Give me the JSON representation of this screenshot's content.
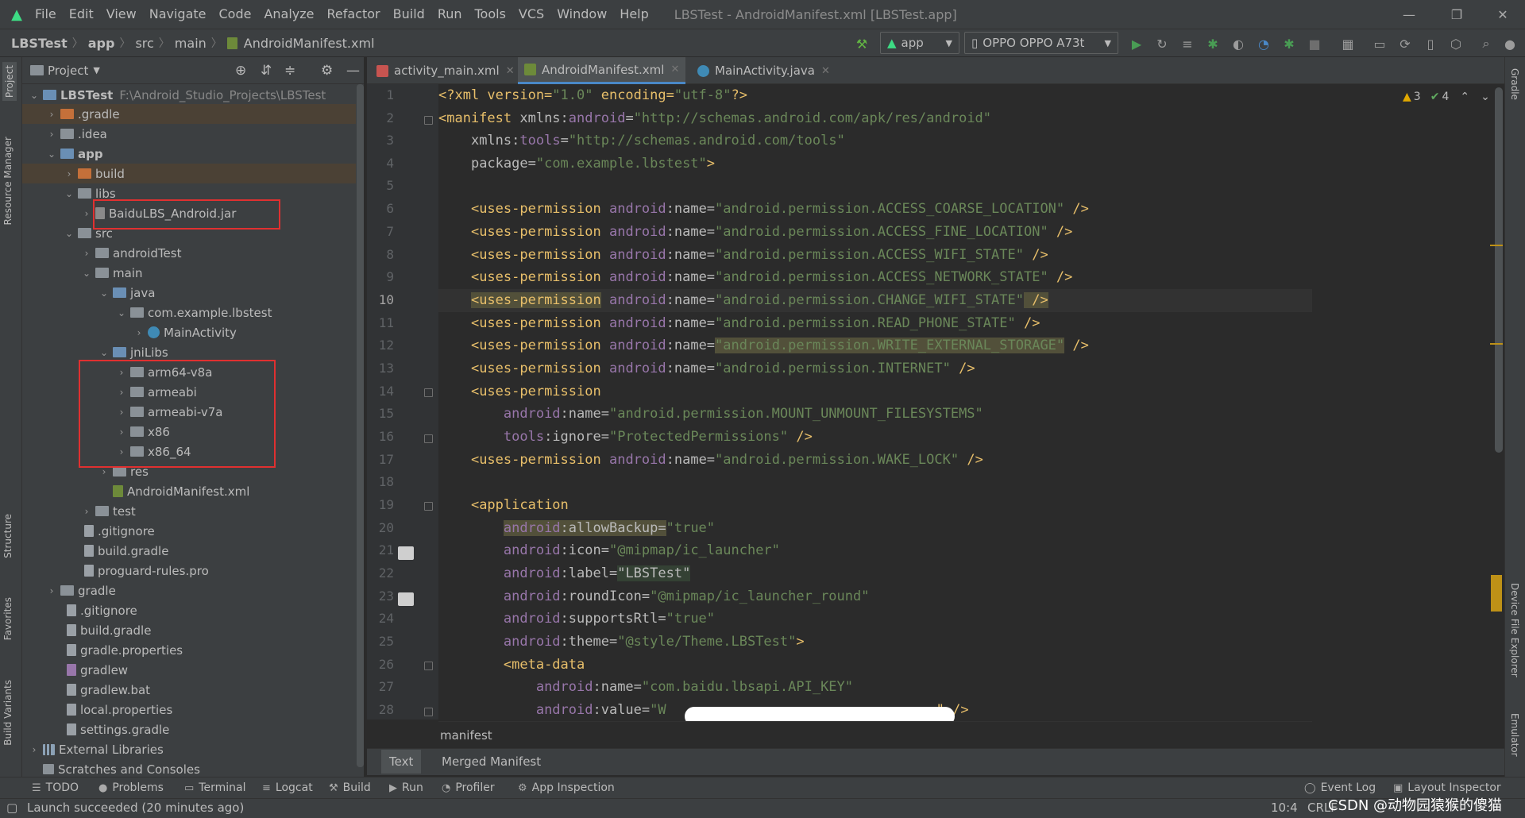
{
  "window": {
    "title": "LBSTest - AndroidManifest.xml [LBSTest.app]"
  },
  "menu": [
    "File",
    "Edit",
    "View",
    "Navigate",
    "Code",
    "Analyze",
    "Refactor",
    "Build",
    "Run",
    "Tools",
    "VCS",
    "Window",
    "Help"
  ],
  "breadcrumb": [
    "LBSTest",
    "app",
    "src",
    "main",
    "AndroidManifest.xml"
  ],
  "toolbar": {
    "run_config": "app",
    "device": "OPPO OPPO A73t"
  },
  "left_tool_tabs": [
    "Project",
    "Resource Manager",
    "Structure",
    "Favorites",
    "Build Variants"
  ],
  "right_tool_tabs": [
    "Gradle",
    "Device File Explorer",
    "Emulator"
  ],
  "project_panel": {
    "title": "Project",
    "tree": [
      {
        "label": "LBSTest",
        "extra": "F:\\Android_Studio_Projects\\LBSTest"
      },
      {
        "label": ".gradle"
      },
      {
        "label": ".idea"
      },
      {
        "label": "app"
      },
      {
        "label": "build"
      },
      {
        "label": "libs"
      },
      {
        "label": "BaiduLBS_Android.jar"
      },
      {
        "label": "src"
      },
      {
        "label": "androidTest"
      },
      {
        "label": "main"
      },
      {
        "label": "java"
      },
      {
        "label": "com.example.lbstest"
      },
      {
        "label": "MainActivity"
      },
      {
        "label": "jniLibs"
      },
      {
        "label": "arm64-v8a"
      },
      {
        "label": "armeabi"
      },
      {
        "label": "armeabi-v7a"
      },
      {
        "label": "x86"
      },
      {
        "label": "x86_64"
      },
      {
        "label": "res"
      },
      {
        "label": "AndroidManifest.xml"
      },
      {
        "label": "test"
      },
      {
        "label": ".gitignore"
      },
      {
        "label": "build.gradle"
      },
      {
        "label": "proguard-rules.pro"
      },
      {
        "label": "gradle"
      },
      {
        "label": ".gitignore"
      },
      {
        "label": "build.gradle"
      },
      {
        "label": "gradle.properties"
      },
      {
        "label": "gradlew"
      },
      {
        "label": "gradlew.bat"
      },
      {
        "label": "local.properties"
      },
      {
        "label": "settings.gradle"
      },
      {
        "label": "External Libraries"
      },
      {
        "label": "Scratches and Consoles"
      }
    ]
  },
  "editor_tabs": [
    "activity_main.xml",
    "AndroidManifest.xml",
    "MainActivity.java"
  ],
  "inspections": {
    "warnings": "3",
    "weak_warnings": "4"
  },
  "code": {
    "line_numbers": [
      "1",
      "2",
      "3",
      "4",
      "5",
      "6",
      "7",
      "8",
      "9",
      "10",
      "11",
      "12",
      "13",
      "14",
      "15",
      "16",
      "17",
      "18",
      "19",
      "20",
      "21",
      "22",
      "23",
      "24",
      "25",
      "26",
      "27",
      "28"
    ],
    "l1": {
      "t1": "<?xml version=",
      "t2": "\"1.0\"",
      "t3": " encoding=",
      "t4": "\"utf-8\"",
      "t5": "?>"
    },
    "l2": {
      "t1": "<manifest ",
      "t2": "xmlns:",
      "t3": "android",
      "t4": "=",
      "t5": "\"http://schemas.android.com/apk/res/android\""
    },
    "l3": {
      "t1": "xmlns:",
      "t2": "tools",
      "t3": "=",
      "t4": "\"http://schemas.android.com/tools\""
    },
    "l4": {
      "t1": "package=",
      "t2": "\"com.example.lbstest\"",
      "t3": ">"
    },
    "tag_uses_permission": "<uses-permission",
    "attr_android": "android",
    "attr_name": ":name=",
    "close_tag": " />",
    "permissions": [
      "\"android.permission.ACCESS_COARSE_LOCATION\"",
      "\"android.permission.ACCESS_FINE_LOCATION\"",
      "\"android.permission.ACCESS_WIFI_STATE\"",
      "\"android.permission.ACCESS_NETWORK_STATE\"",
      "\"android.permission.CHANGE_WIFI_STATE\"",
      "\"android.permission.READ_PHONE_STATE\"",
      "\"android.permission.WRITE_EXTERNAL_STORAGE\"",
      "\"android.permission.INTERNET\""
    ],
    "l15_value": "\"android.permission.MOUNT_UNMOUNT_FILESYSTEMS\"",
    "l16": {
      "t1": "tools",
      "t2": ":ignore=",
      "t3": "\"ProtectedPermissions\"",
      "t4": " />"
    },
    "l17_value": "\"android.permission.WAKE_LOCK\"",
    "l19": "<application",
    "app_attrs": [
      {
        "name": ":allowBackup=",
        "value": "\"true\""
      },
      {
        "name": ":icon=",
        "value": "\"@mipmap/ic_launcher\""
      },
      {
        "name": ":label=",
        "value": "\"LBSTest\""
      },
      {
        "name": ":roundIcon=",
        "value": "\"@mipmap/ic_launcher_round\""
      },
      {
        "name": ":supportsRtl=",
        "value": "\"true\""
      },
      {
        "name": ":theme=",
        "value": "\"@style/Theme.LBSTest\"",
        "end": ">"
      }
    ],
    "l26": "<meta-data",
    "l27": {
      "name": ":name=",
      "value": "\"com.baidu.lbsapi.API_KEY\""
    },
    "l28": {
      "name": ":value=",
      "value": "\"W",
      "end": "\" />"
    }
  },
  "editor_breadcrumb": "manifest",
  "editor_bottom_tabs": [
    "Text",
    "Merged Manifest"
  ],
  "bottom_tools": [
    "TODO",
    "Problems",
    "Terminal",
    "Logcat",
    "Build",
    "Run",
    "Profiler",
    "App Inspection"
  ],
  "bottom_right_tools": [
    "Event Log",
    "Layout Inspector"
  ],
  "status": {
    "message": "Launch succeeded (20 minutes ago)",
    "position": "10:4",
    "line_sep": "CRLF",
    "watermark": "CSDN @动物园猿猴的傻猫"
  }
}
